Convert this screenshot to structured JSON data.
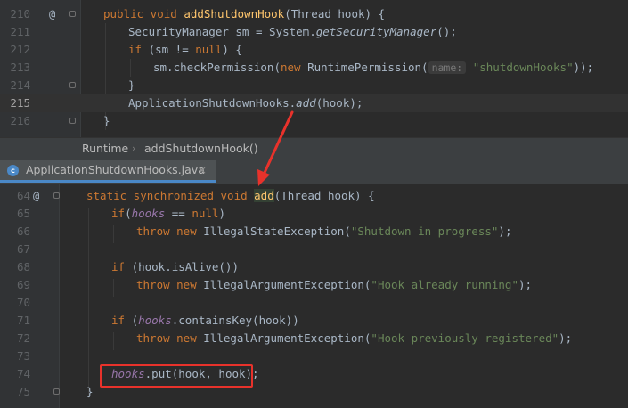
{
  "top_editor": {
    "lines": [
      {
        "num": "210",
        "annotation": "@",
        "fold": true,
        "tokens": [
          [
            "kw",
            "public void "
          ],
          [
            "fn",
            "addShutdownHook"
          ],
          [
            "",
            "(Thread hook) {"
          ]
        ]
      },
      {
        "num": "211",
        "tokens": [
          [
            "",
            "SecurityManager sm = System."
          ],
          [
            "it",
            "getSecurityManager"
          ],
          [
            "",
            "();"
          ]
        ]
      },
      {
        "num": "212",
        "tokens": [
          [
            "kw",
            "if "
          ],
          [
            "",
            "(sm != "
          ],
          [
            "kw",
            "null"
          ],
          [
            "",
            ") {"
          ]
        ]
      },
      {
        "num": "213",
        "tokens": [
          [
            "",
            "sm.checkPermission("
          ],
          [
            "kw",
            "new "
          ],
          [
            "",
            "RuntimePermission("
          ],
          [
            "hint",
            "name:"
          ],
          [
            "str",
            " \"shutdownHooks\""
          ],
          [
            "",
            "));"
          ]
        ]
      },
      {
        "num": "214",
        "fold": true,
        "tokens": [
          [
            "",
            "}"
          ]
        ]
      },
      {
        "num": "215",
        "current": true,
        "caret": true,
        "tokens": [
          [
            "",
            "ApplicationShutdownHooks."
          ],
          [
            "it",
            "add"
          ],
          [
            "",
            "(hook);"
          ]
        ]
      },
      {
        "num": "216",
        "fold": true,
        "tokens": [
          [
            "",
            "}"
          ]
        ]
      }
    ]
  },
  "breadcrumb": {
    "class_name": "Runtime",
    "separator": "›",
    "method_name": "addShutdownHook()"
  },
  "tab": {
    "file_name": "ApplicationShutdownHooks.java",
    "close": "×",
    "icon_letter": "c"
  },
  "bottom_editor": {
    "lines": [
      {
        "num": "64",
        "annotation": "@",
        "fold": true,
        "tokens": [
          [
            "kw",
            "static synchronized void "
          ],
          [
            "hlw",
            "add"
          ],
          [
            "",
            "(Thread hook) {"
          ]
        ]
      },
      {
        "num": "65",
        "tokens": [
          [
            "kw",
            "if"
          ],
          [
            "",
            "("
          ],
          [
            "fld",
            "hooks"
          ],
          [
            "",
            " == "
          ],
          [
            "kw",
            "null"
          ],
          [
            "",
            ")"
          ]
        ]
      },
      {
        "num": "66",
        "tokens": [
          [
            "kw",
            "throw new "
          ],
          [
            "",
            "IllegalStateException("
          ],
          [
            "str",
            "\"Shutdown in progress\""
          ],
          [
            "",
            ");"
          ]
        ]
      },
      {
        "num": "67",
        "tokens": []
      },
      {
        "num": "68",
        "tokens": [
          [
            "kw",
            "if "
          ],
          [
            "",
            "(hook.isAlive())"
          ]
        ]
      },
      {
        "num": "69",
        "tokens": [
          [
            "kw",
            "throw new "
          ],
          [
            "",
            "IllegalArgumentException("
          ],
          [
            "str",
            "\"Hook already running\""
          ],
          [
            "",
            ");"
          ]
        ]
      },
      {
        "num": "70",
        "tokens": []
      },
      {
        "num": "71",
        "tokens": [
          [
            "kw",
            "if "
          ],
          [
            "",
            "("
          ],
          [
            "fld",
            "hooks"
          ],
          [
            "",
            ".containsKey(hook))"
          ]
        ]
      },
      {
        "num": "72",
        "tokens": [
          [
            "kw",
            "throw new "
          ],
          [
            "",
            "IllegalArgumentException("
          ],
          [
            "str",
            "\"Hook previously registered\""
          ],
          [
            "",
            ");"
          ]
        ]
      },
      {
        "num": "73",
        "tokens": []
      },
      {
        "num": "74",
        "tokens": [
          [
            "fld",
            "hooks"
          ],
          [
            "",
            ".put(hook, hook);"
          ]
        ]
      },
      {
        "num": "75",
        "fold": true,
        "tokens": [
          [
            "",
            "}"
          ]
        ]
      }
    ]
  },
  "colors": {
    "annotation_box": "#e8322b",
    "arrow": "#e8322b",
    "tab_underline": "#4a88c7"
  }
}
